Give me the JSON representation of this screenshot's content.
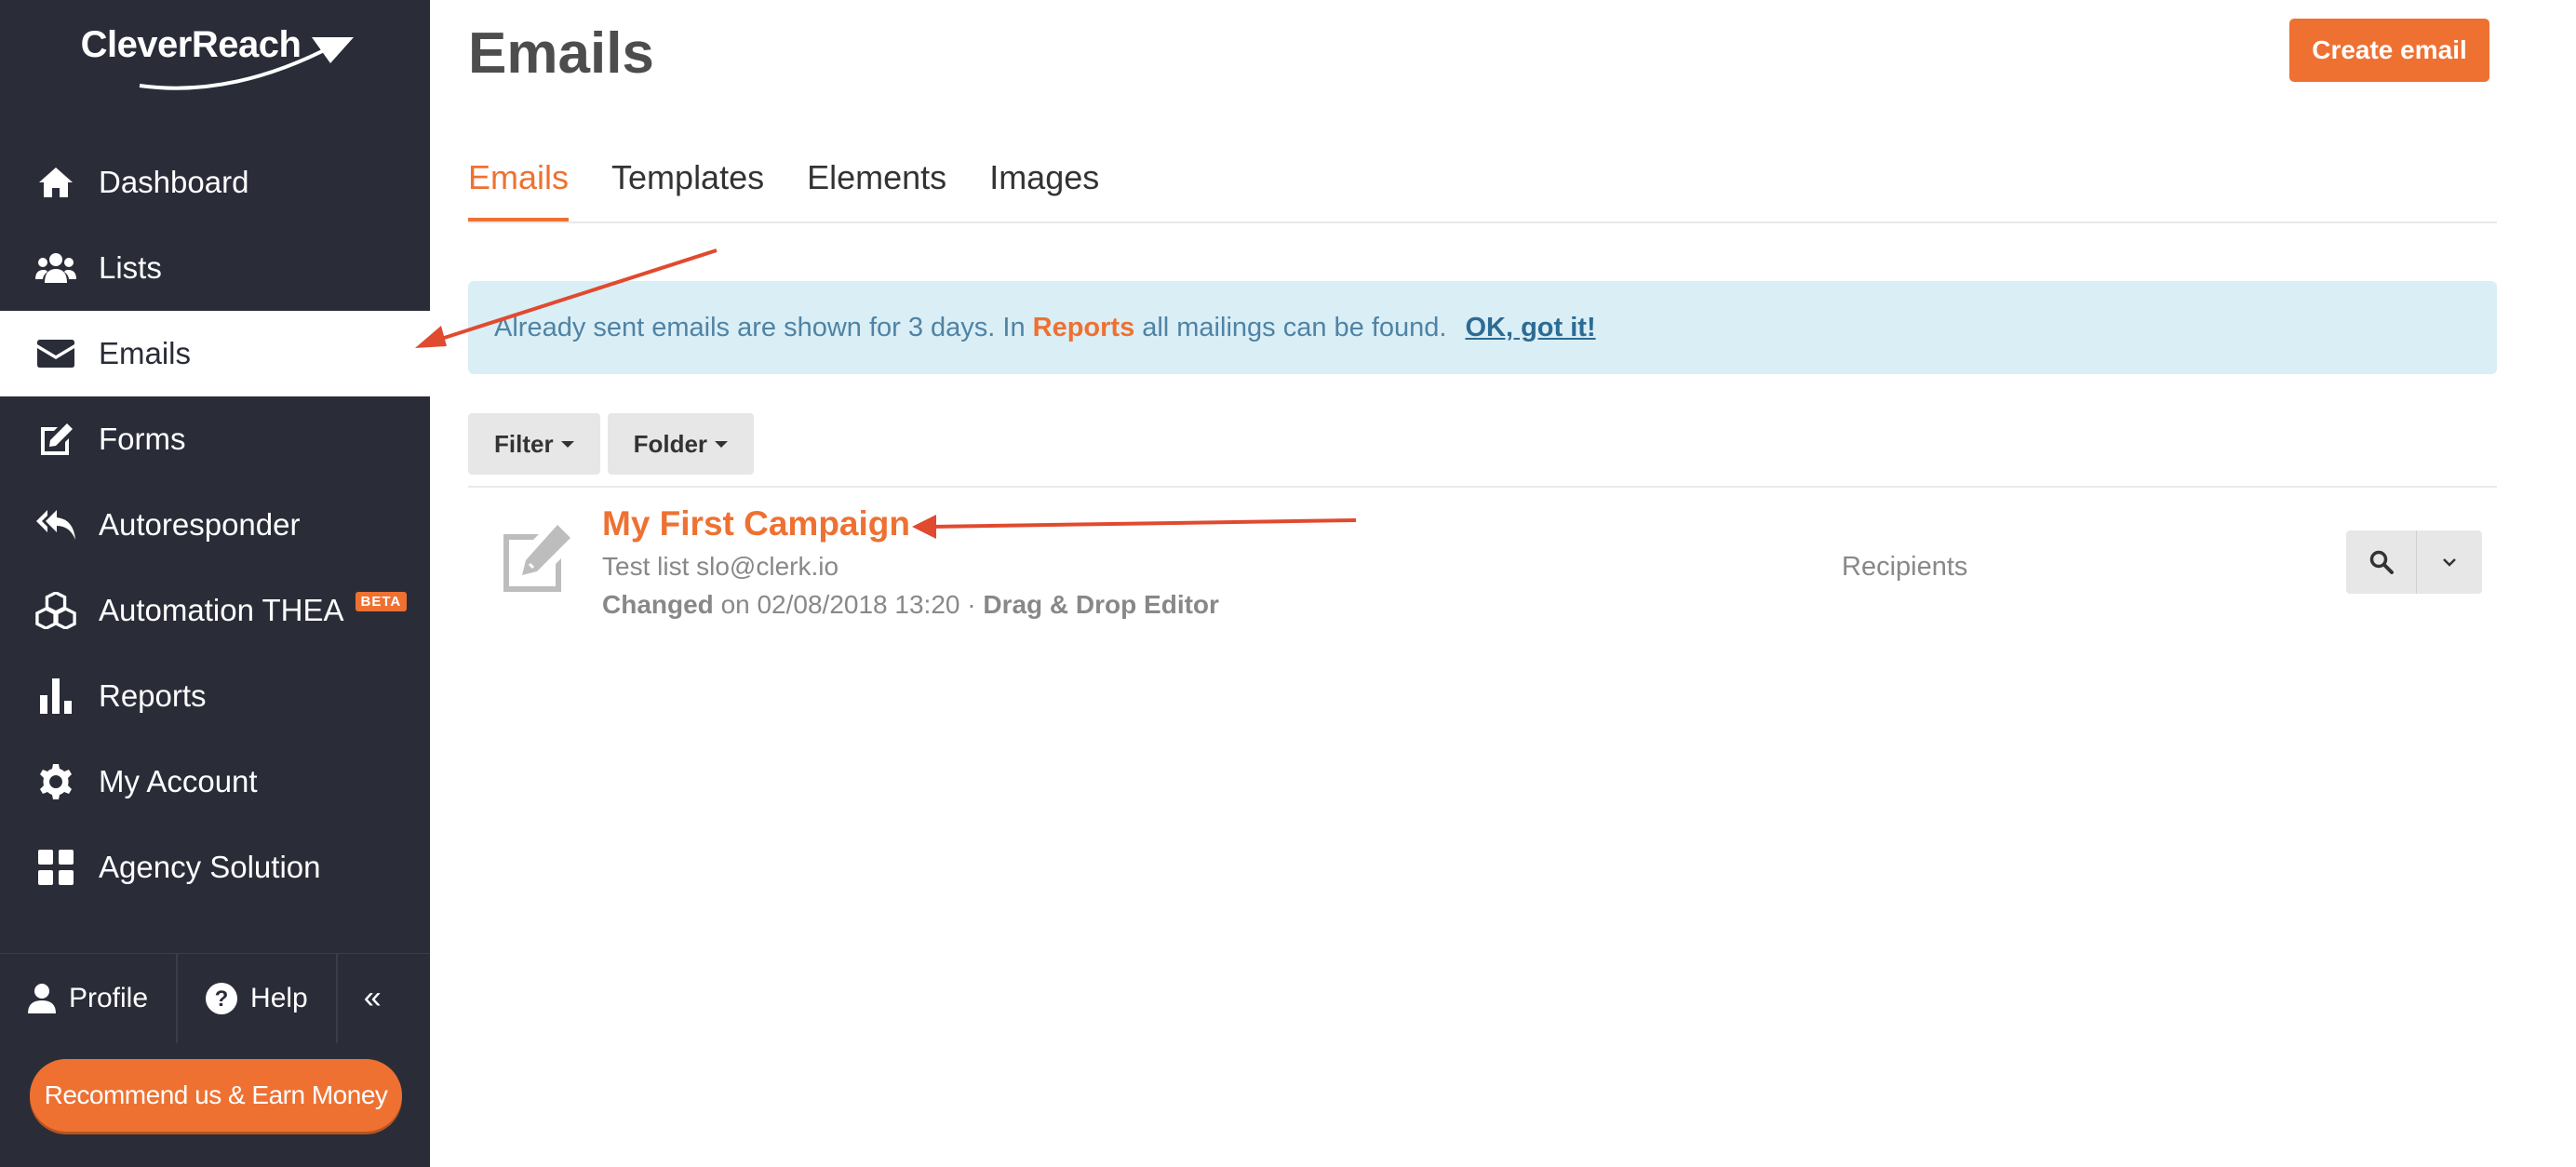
{
  "app": {
    "logo": "CleverReach"
  },
  "sidebar": {
    "items": [
      {
        "label": "Dashboard",
        "icon": "home-icon"
      },
      {
        "label": "Lists",
        "icon": "users-icon"
      },
      {
        "label": "Emails",
        "icon": "envelope-icon",
        "active": true
      },
      {
        "label": "Forms",
        "icon": "edit-icon"
      },
      {
        "label": "Autoresponder",
        "icon": "reply-all-icon"
      },
      {
        "label": "Automation THEA",
        "icon": "cubes-icon",
        "badge": "BETA"
      },
      {
        "label": "Reports",
        "icon": "bar-chart-icon"
      },
      {
        "label": "My Account",
        "icon": "gear-icon"
      },
      {
        "label": "Agency Solution",
        "icon": "grid-icon"
      }
    ],
    "bottom": {
      "profile": "Profile",
      "help": "Help",
      "collapse": "«"
    },
    "recommend": "Recommend us & Earn Money"
  },
  "header": {
    "title": "Emails",
    "create_button": "Create email"
  },
  "tabs": [
    "Emails",
    "Templates",
    "Elements",
    "Images"
  ],
  "alert": {
    "text_before": "Already sent emails are shown for 3 days. In",
    "highlight": "Reports",
    "text_after": "all mailings can be found.",
    "link": "OK, got it!"
  },
  "toolbar": {
    "filter": "Filter",
    "folder": "Folder"
  },
  "emails": [
    {
      "title": "My First Campaign",
      "list": "Test list slo@clerk.io",
      "changed_label": "Changed",
      "changed_text": "on 02/08/2018 13:20 ·",
      "editor": "Drag & Drop Editor",
      "recipients_label": "Recipients"
    }
  ],
  "colors": {
    "accent": "#ee7132",
    "sidebar": "#2a2d38",
    "alert_bg": "#daeef6",
    "annotation": "#e04a2f"
  }
}
